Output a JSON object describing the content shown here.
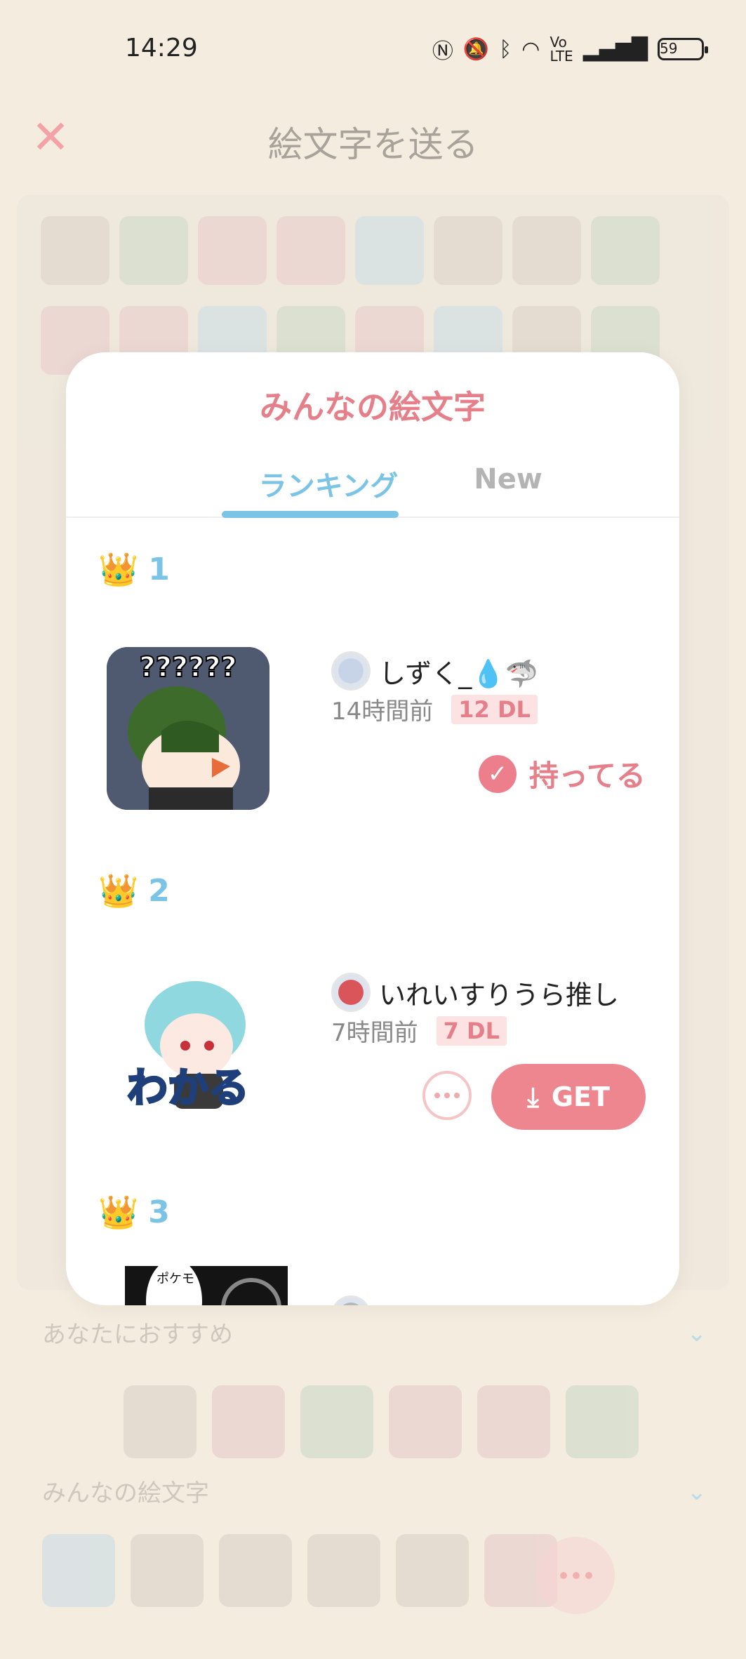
{
  "status_bar": {
    "time": "14:29",
    "battery": "59"
  },
  "header": {
    "title": "絵文字を送る"
  },
  "sections": {
    "recommended": "あなたにおすすめ",
    "everyone": "みんなの絵文字"
  },
  "modal": {
    "title": "みんなの絵文字",
    "tabs": [
      {
        "label": "ランキング",
        "active": true
      },
      {
        "label": "New",
        "active": false
      }
    ],
    "items": [
      {
        "rank": "1",
        "username": "しずく_💧🦈",
        "time_ago": "14時間前",
        "downloads": "12 DL",
        "owned_label": "持ってる",
        "sticker_text": "??????"
      },
      {
        "rank": "2",
        "username": "いれいすりうら推し",
        "time_ago": "7時間前",
        "downloads": "7 DL",
        "get_label": "GET",
        "sticker_text": "わかる"
      },
      {
        "rank": "3",
        "sticker_text": "ポケモ"
      }
    ]
  },
  "colors": {
    "accent_pink": "#e57f89",
    "accent_blue": "#7cc4e6"
  }
}
